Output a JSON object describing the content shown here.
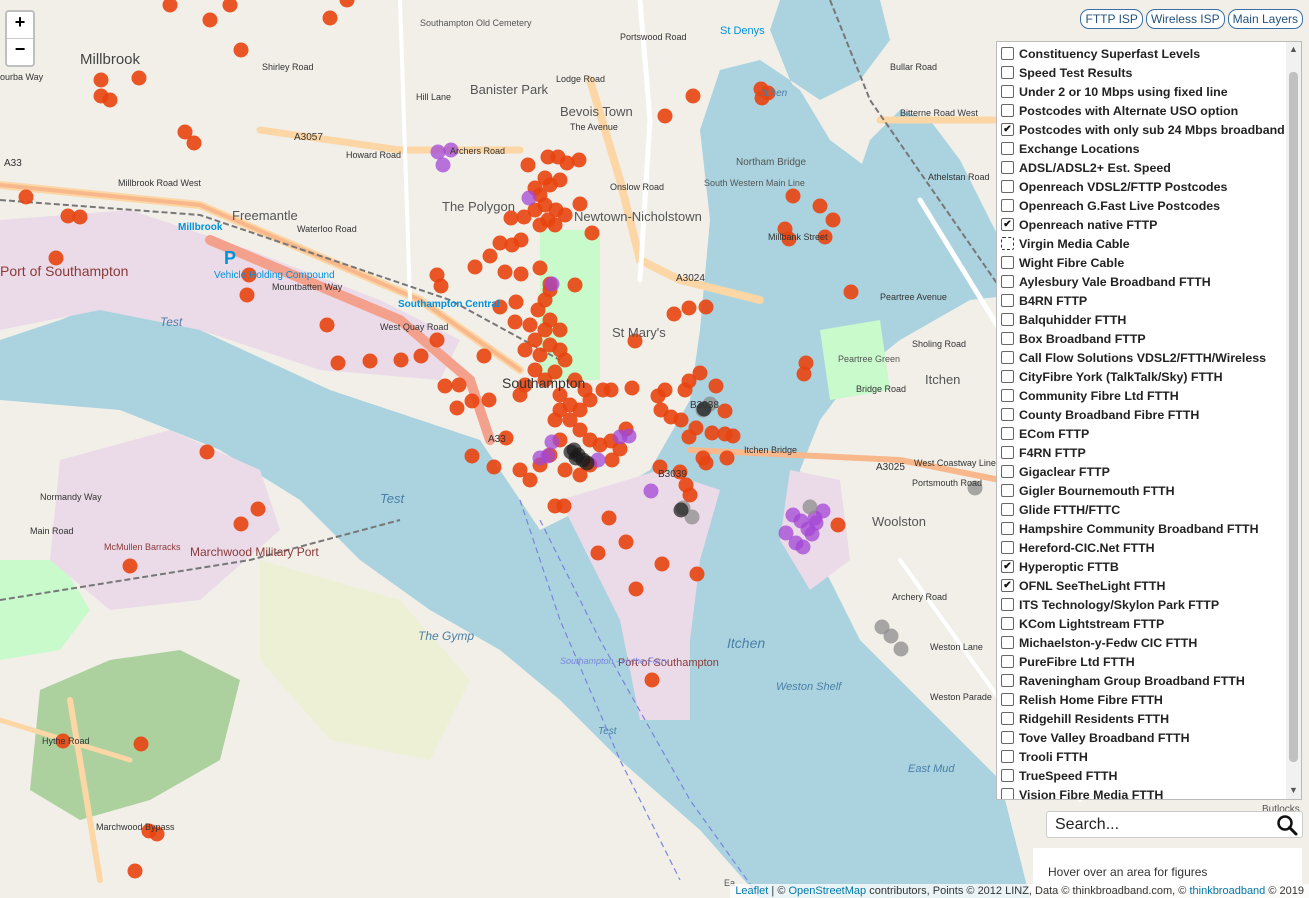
{
  "map": {
    "zoom_in": "+",
    "zoom_out": "−",
    "place_labels": [
      {
        "id": "millbrook",
        "text": "Millbrook"
      },
      {
        "id": "banister-park",
        "text": "Banister Park"
      },
      {
        "id": "bevois-town",
        "text": "Bevois Town"
      },
      {
        "id": "the-polygon",
        "text": "The Polygon"
      },
      {
        "id": "newtown-nicholstown",
        "text": "Newtown-Nicholstown"
      },
      {
        "id": "freemantle",
        "text": "Freemantle"
      },
      {
        "id": "st-marys",
        "text": "St Mary's"
      },
      {
        "id": "southampton",
        "text": "Southampton"
      },
      {
        "id": "northam-bridge",
        "text": "Northam Bridge"
      },
      {
        "id": "peartree-green",
        "text": "Peartree Green"
      },
      {
        "id": "itchen",
        "text": "Itchen"
      },
      {
        "id": "woolston",
        "text": "Woolston"
      },
      {
        "id": "marchwood-military-port",
        "text": "Marchwood Military Port"
      },
      {
        "id": "mcmullen-barracks",
        "text": "McMullen Barracks"
      },
      {
        "id": "port-of-southampton-left",
        "text": "Port of Southampton"
      },
      {
        "id": "port-of-southampton",
        "text": "Port of Southampton"
      },
      {
        "id": "st-denys",
        "text": "St Denys"
      },
      {
        "id": "southampton-old-cemetery",
        "text": "Southampton Old Cemetery"
      },
      {
        "id": "vehicle-holding-compound",
        "text": "Vehicle Holding Compound"
      },
      {
        "id": "southampton-central",
        "text": "Southampton Central"
      },
      {
        "id": "millbrook-station",
        "text": "Millbrook"
      }
    ],
    "water_labels": [
      {
        "id": "test-1",
        "text": "Test"
      },
      {
        "id": "test-2",
        "text": "Test"
      },
      {
        "id": "test-3",
        "text": "Test"
      },
      {
        "id": "the-gymp",
        "text": "The Gymp"
      },
      {
        "id": "itchen-water",
        "text": "Itchen"
      },
      {
        "id": "weston-shelf",
        "text": "Weston Shelf"
      },
      {
        "id": "east-mud",
        "text": "East Mud"
      },
      {
        "id": "itchen-river",
        "text": "Itchen"
      }
    ],
    "road_labels": [
      {
        "id": "a33-left",
        "text": "A33"
      },
      {
        "id": "a3057",
        "text": "A3057"
      },
      {
        "id": "a3024",
        "text": "A3024"
      },
      {
        "id": "a33-mid",
        "text": "A33"
      },
      {
        "id": "b3039",
        "text": "B3039"
      },
      {
        "id": "b3038",
        "text": "B3038"
      },
      {
        "id": "a3025",
        "text": "A3025"
      },
      {
        "id": "millbrook-road-west",
        "text": "Millbrook Road West"
      },
      {
        "id": "mountbatten-way",
        "text": "Mountbatten Way"
      },
      {
        "id": "west-quay-road",
        "text": "West Quay Road"
      },
      {
        "id": "howard-road",
        "text": "Howard Road"
      },
      {
        "id": "waterloo-road",
        "text": "Waterloo Road"
      },
      {
        "id": "shirley-road",
        "text": "Shirley Road"
      },
      {
        "id": "hill-lane",
        "text": "Hill Lane"
      },
      {
        "id": "archers-road",
        "text": "Archers Road"
      },
      {
        "id": "lodge-road",
        "text": "Lodge Road"
      },
      {
        "id": "the-avenue",
        "text": "The Avenue"
      },
      {
        "id": "onslow-road",
        "text": "Onslow Road"
      },
      {
        "id": "portswood-road",
        "text": "Portswood Road"
      },
      {
        "id": "bitterne-road-west",
        "text": "Bitterne Road West"
      },
      {
        "id": "bullar-road",
        "text": "Bullar Road"
      },
      {
        "id": "athelstan-road",
        "text": "Athelstan Road"
      },
      {
        "id": "peartree-avenue",
        "text": "Peartree Avenue"
      },
      {
        "id": "sholing-road",
        "text": "Sholing Road"
      },
      {
        "id": "bridge-road",
        "text": "Bridge Road"
      },
      {
        "id": "itchen-bridge",
        "text": "Itchen Bridge"
      },
      {
        "id": "portsmouth-road",
        "text": "Portsmouth Road"
      },
      {
        "id": "west-coastway-line",
        "text": "West Coastway Line"
      },
      {
        "id": "weston-lane",
        "text": "Weston Lane"
      },
      {
        "id": "archery-road",
        "text": "Archery Road"
      },
      {
        "id": "weston-parade",
        "text": "Weston Parade"
      },
      {
        "id": "normandy-way",
        "text": "Normandy Way"
      },
      {
        "id": "main-road",
        "text": "Main Road"
      },
      {
        "id": "marchwood-bypass",
        "text": "Marchwood Bypass"
      },
      {
        "id": "hythe-road",
        "text": "Hythe Road"
      },
      {
        "id": "southampton-hythe-ferry",
        "text": "Southampton - Hythe Ferry"
      },
      {
        "id": "south-western-main-line",
        "text": "South Western Main Line"
      },
      {
        "id": "millbank-street",
        "text": "Millbank Street"
      },
      {
        "id": "ourbay-way",
        "text": "ourba Way"
      },
      {
        "id": "butlocks",
        "text": "Butlocks"
      },
      {
        "id": "ea",
        "text": "Ea"
      }
    ],
    "marker_colors": {
      "orange": "#e8440f",
      "purple": "#a347d6",
      "grey": "#8c8c8c",
      "black": "#1a1a1a"
    },
    "icons": {
      "parking": "P"
    }
  },
  "top_buttons": [
    "FTTP ISP",
    "Wireless ISP",
    "Main Layers"
  ],
  "layers": [
    {
      "label": "Constituency Superfast Levels",
      "checked": false
    },
    {
      "label": "Speed Test Results",
      "checked": false
    },
    {
      "label": "Under 2 or 10 Mbps using fixed line",
      "checked": false
    },
    {
      "label": "Postcodes with Alternate USO option",
      "checked": false
    },
    {
      "label": "Postcodes with only sub 24 Mbps broadband",
      "checked": true
    },
    {
      "label": "Exchange Locations",
      "checked": false
    },
    {
      "label": "ADSL/ADSL2+ Est. Speed",
      "checked": false
    },
    {
      "label": "Openreach VDSL2/FTTP Postcodes",
      "checked": false
    },
    {
      "label": "Openreach G.Fast Live Postcodes",
      "checked": false
    },
    {
      "label": "Openreach native FTTP",
      "checked": true
    },
    {
      "label": "Virgin Media Cable",
      "checked": false,
      "focused": true
    },
    {
      "label": "Wight Fibre Cable",
      "checked": false
    },
    {
      "label": "Aylesbury Vale Broadband FTTH",
      "checked": false
    },
    {
      "label": "B4RN FTTP",
      "checked": false
    },
    {
      "label": "Balquhidder FTTH",
      "checked": false
    },
    {
      "label": "Box Broadband FTTP",
      "checked": false
    },
    {
      "label": "Call Flow Solutions VDSL2/FTTH/Wireless",
      "checked": false
    },
    {
      "label": "CityFibre York (TalkTalk/Sky) FTTH",
      "checked": false
    },
    {
      "label": "Community Fibre Ltd FTTH",
      "checked": false
    },
    {
      "label": "County Broadband Fibre FTTH",
      "checked": false
    },
    {
      "label": "ECom FTTP",
      "checked": false
    },
    {
      "label": "F4RN FTTP",
      "checked": false
    },
    {
      "label": "Gigaclear FTTP",
      "checked": false
    },
    {
      "label": "Gigler Bournemouth FTTH",
      "checked": false
    },
    {
      "label": "Glide FTTH/FTTC",
      "checked": false
    },
    {
      "label": "Hampshire Community Broadband FTTH",
      "checked": false
    },
    {
      "label": "Hereford-CIC.Net FTTH",
      "checked": false
    },
    {
      "label": "Hyperoptic FTTB",
      "checked": true
    },
    {
      "label": "OFNL SeeTheLight FTTH",
      "checked": true
    },
    {
      "label": "ITS Technology/Skylon Park FTTP",
      "checked": false
    },
    {
      "label": "KCom Lightstream FTTP",
      "checked": false
    },
    {
      "label": "Michaelston-y-Fedw CIC FTTH",
      "checked": false
    },
    {
      "label": "PureFibre Ltd FTTH",
      "checked": false
    },
    {
      "label": "Raveningham Group Broadband FTTH",
      "checked": false
    },
    {
      "label": "Relish Home Fibre FTTH",
      "checked": false
    },
    {
      "label": "Ridgehill Residents FTTH",
      "checked": false
    },
    {
      "label": "Tove Valley Broadband FTTH",
      "checked": false
    },
    {
      "label": "Trooli FTTH",
      "checked": false
    },
    {
      "label": "TrueSpeed FTTH",
      "checked": false
    },
    {
      "label": "Vision Fibre Media FTTH",
      "checked": false
    }
  ],
  "search": {
    "placeholder": "Search..."
  },
  "info": {
    "text": "Hover over an area for figures"
  },
  "attribution": {
    "leaflet": "Leaflet",
    "sep": " | © ",
    "osm": "OpenStreetMap",
    "rest": " contributors, Points © 2012 LINZ, Data © thinkbroadband.com, © ",
    "tbb": "thinkbroadband",
    "year": " © 2019"
  }
}
